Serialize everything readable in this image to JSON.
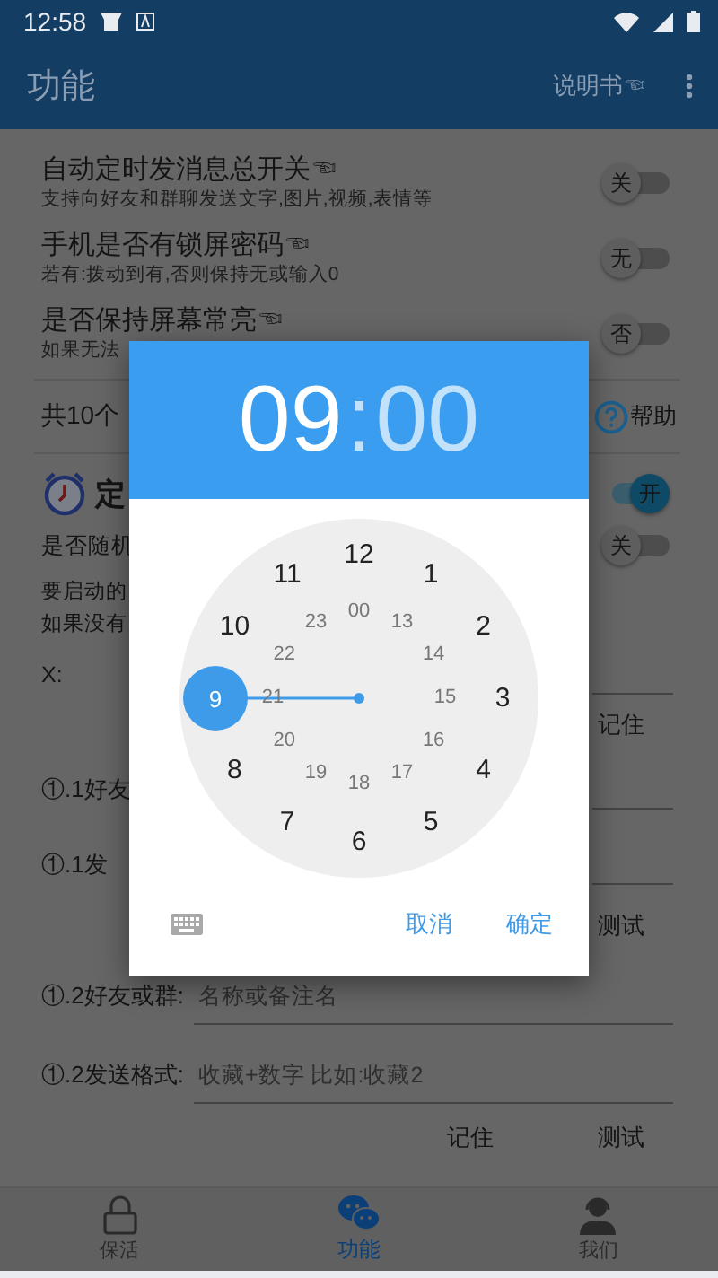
{
  "status_bar": {
    "time": "12:58"
  },
  "app_bar": {
    "title": "功能",
    "action": "说明书☜"
  },
  "settings": [
    {
      "title": "自动定时发消息总开关☜",
      "subtitle": "支持向好友和群聊发送文字,图片,视频,表情等",
      "switch_label": "关",
      "on": false
    },
    {
      "title": "手机是否有锁屏密码☜",
      "subtitle": "若有:拨动到有,否则保持无或输入0",
      "switch_label": "无",
      "on": false
    },
    {
      "title": "是否保持屏幕常亮☜",
      "subtitle": "如果无法",
      "switch_label": "否",
      "on": false
    }
  ],
  "summary": {
    "text": "共10个",
    "help": "帮助"
  },
  "timer": {
    "title": "定",
    "switch_label": "开",
    "on": true,
    "random": {
      "label": "是否随机",
      "switch_label": "关",
      "on": false
    },
    "notes": [
      "要启动的",
      "如果没有"
    ],
    "x_label": "X:",
    "remember": "记住"
  },
  "tasks": [
    {
      "label": "①.1好友"
    },
    {
      "label": "①.1发",
      "test": "测试"
    },
    {
      "label": "①.2好友或群:",
      "placeholder": "名称或备注名"
    },
    {
      "label": "①.2发送格式:",
      "placeholder": "收藏+数字 比如:收藏2"
    }
  ],
  "task_buttons": [
    "记住",
    "测试"
  ],
  "dialog": {
    "hour": {
      "text": "09",
      "selected": true
    },
    "separator": ":",
    "minute": {
      "text": "00",
      "selected": false
    },
    "outer": [
      {
        "label": "12",
        "selected": false
      },
      {
        "label": "1",
        "selected": false
      },
      {
        "label": "2",
        "selected": false
      },
      {
        "label": "3",
        "selected": false
      },
      {
        "label": "4",
        "selected": false
      },
      {
        "label": "5",
        "selected": false
      },
      {
        "label": "6",
        "selected": false
      },
      {
        "label": "7",
        "selected": false
      },
      {
        "label": "8",
        "selected": false
      },
      {
        "label": "9",
        "selected": true
      },
      {
        "label": "10",
        "selected": false
      },
      {
        "label": "11",
        "selected": false
      }
    ],
    "inner": [
      "00",
      "13",
      "14",
      "15",
      "16",
      "17",
      "18",
      "19",
      "20",
      "21",
      "22",
      "23"
    ],
    "buttons": [
      "取消",
      "确定"
    ]
  },
  "nav": [
    {
      "label": "保活",
      "kind": "lock",
      "selected": false
    },
    {
      "label": "功能",
      "kind": "chat",
      "selected": true
    },
    {
      "label": "我们",
      "kind": "agent",
      "selected": false
    }
  ]
}
